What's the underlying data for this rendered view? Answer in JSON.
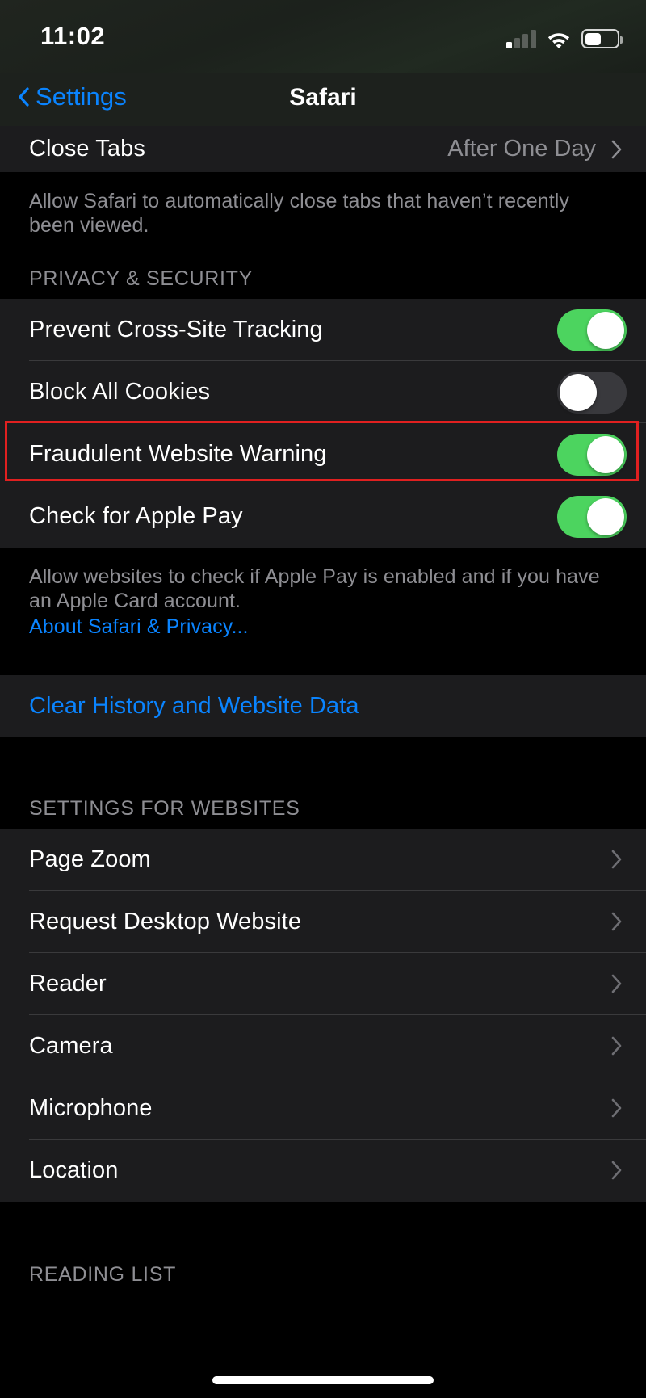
{
  "status_bar": {
    "time": "11:02",
    "signal_icon": "cellular-signal-icon",
    "signal_bars_filled": 1,
    "signal_bars_total": 4,
    "wifi_icon": "wifi-icon",
    "battery_icon": "battery-icon",
    "battery_percent": 45
  },
  "nav": {
    "back_label": "Settings",
    "back_icon": "chevron-left-icon",
    "title": "Safari"
  },
  "tabs_group": {
    "rows": [
      {
        "label": "Close Tabs",
        "value": "After One Day",
        "accessory": "chevron-right-icon"
      }
    ],
    "footer": "Allow Safari to automatically close tabs that haven’t recently been viewed."
  },
  "privacy_section": {
    "header": "PRIVACY & SECURITY",
    "rows": [
      {
        "label": "Prevent Cross-Site Tracking",
        "toggle": "on"
      },
      {
        "label": "Block All Cookies",
        "toggle": "off"
      },
      {
        "label": "Fraudulent Website Warning",
        "toggle": "on"
      },
      {
        "label": "Check for Apple Pay",
        "toggle": "on"
      }
    ],
    "footer": "Allow websites to check if Apple Pay is enabled and if you have an Apple Card account.",
    "footer_link": "About Safari & Privacy..."
  },
  "clear_section": {
    "rows": [
      {
        "label": "Clear History and Website Data"
      }
    ]
  },
  "websites_section": {
    "header": "SETTINGS FOR WEBSITES",
    "rows": [
      {
        "label": "Page Zoom",
        "accessory": "chevron-right-icon"
      },
      {
        "label": "Request Desktop Website",
        "accessory": "chevron-right-icon"
      },
      {
        "label": "Reader",
        "accessory": "chevron-right-icon"
      },
      {
        "label": "Camera",
        "accessory": "chevron-right-icon"
      },
      {
        "label": "Microphone",
        "accessory": "chevron-right-icon"
      },
      {
        "label": "Location",
        "accessory": "chevron-right-icon"
      }
    ]
  },
  "reading_list_section": {
    "header": "READING LIST"
  },
  "annotation": {
    "target_label": "Fraudulent Website Warning",
    "color": "#e02020"
  },
  "colors": {
    "accent_blue": "#0a84ff",
    "toggle_on_green": "#4cd45f",
    "toggle_off_gray": "#39393d",
    "row_background": "#1c1c1e",
    "page_background": "#000000",
    "secondary_text": "#8e8e93"
  },
  "home_indicator": "home-indicator"
}
